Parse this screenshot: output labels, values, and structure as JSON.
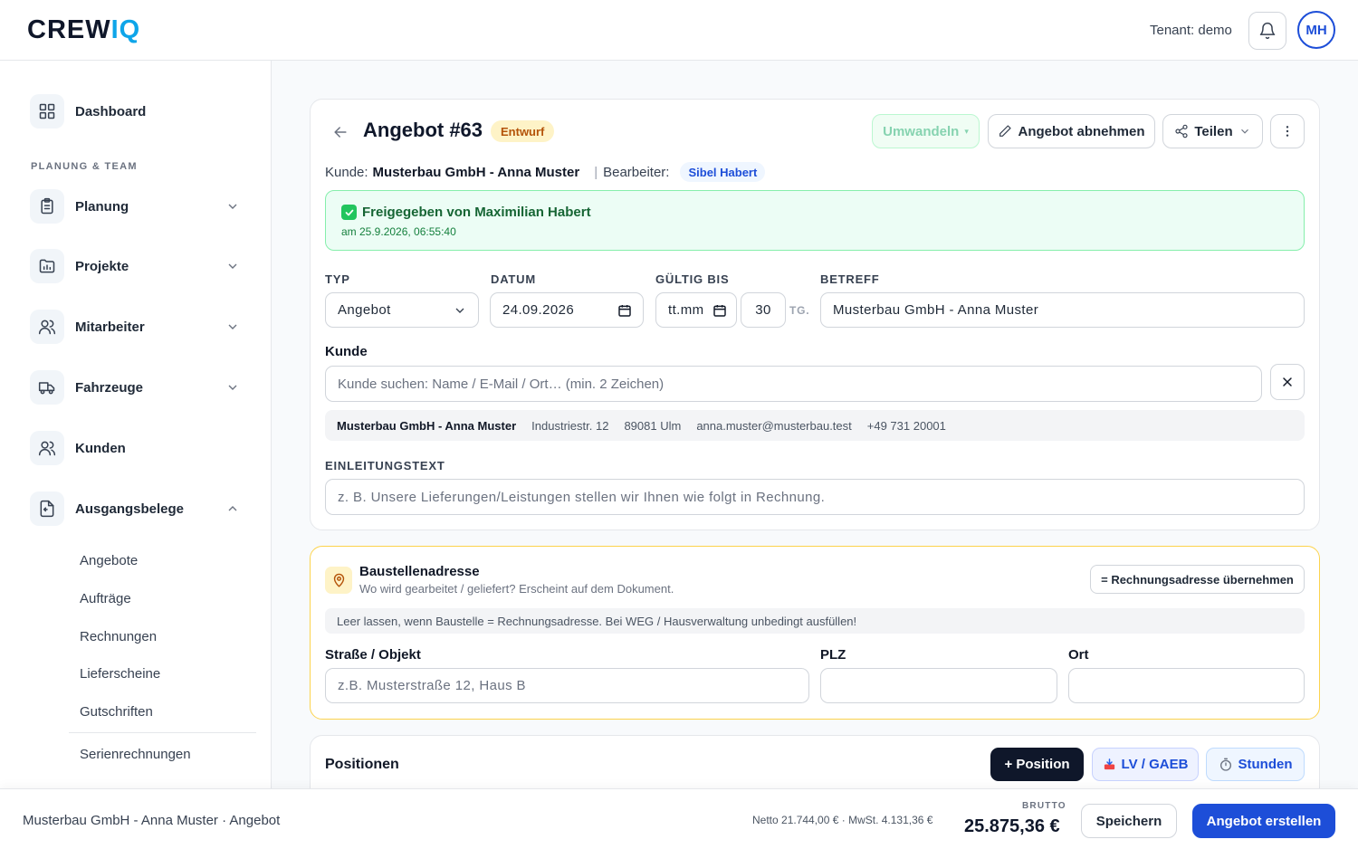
{
  "app": {
    "logo_main": "CREW",
    "logo_accent": "IQ",
    "tenant": "Tenant: demo",
    "user_initials": "MH"
  },
  "sidebar": {
    "dashboard": "Dashboard",
    "section_label": "PLANUNG & TEAM",
    "items": [
      {
        "label": "Planung",
        "icon": "clipboard-icon",
        "expanded": false
      },
      {
        "label": "Projekte",
        "icon": "folder-chart-icon",
        "expanded": false
      },
      {
        "label": "Mitarbeiter",
        "icon": "users-icon",
        "expanded": false
      },
      {
        "label": "Fahrzeuge",
        "icon": "truck-icon",
        "expanded": false
      },
      {
        "label": "Kunden",
        "icon": "users-icon",
        "expanded": null
      },
      {
        "label": "Ausgangsbelege",
        "icon": "document-icon",
        "expanded": true
      }
    ],
    "sub_items": [
      "Angebote",
      "Aufträge",
      "Rechnungen",
      "Lieferscheine",
      "Gutschriften",
      "Serienrechnungen"
    ]
  },
  "header": {
    "title": "Angebot #63",
    "status": "Entwurf",
    "convert_label": "Umwandeln",
    "accept_label": "Angebot abnehmen",
    "share_label": "Teilen",
    "customer_label": "Kunde:",
    "customer_value": "Musterbau GmbH - Anna Muster",
    "separator": "|",
    "editor_label": "Bearbeiter:",
    "editor_value": "Sibel Habert"
  },
  "approval": {
    "title": "Freigegeben von Maximilian Habert",
    "date": "am 25.9.2026, 06:55:40"
  },
  "form": {
    "typ_label": "TYP",
    "typ_value": "Angebot",
    "datum_label": "DATUM",
    "datum_value": "24.09.2026",
    "gueltig_label": "GÜLTIG BIS",
    "gueltig_value": "tt.mm",
    "days_value": "30",
    "days_unit": "TG.",
    "betreff_label": "BETREFF",
    "betreff_value": "Musterbau GmbH - Anna Muster",
    "kunde_label": "Kunde",
    "kunde_placeholder": "Kunde suchen: Name / E-Mail / Ort… (min. 2 Zeichen)",
    "customer": {
      "name": "Musterbau GmbH - Anna Muster",
      "street": "Industriestr. 12",
      "city": "89081 Ulm",
      "email": "anna.muster@musterbau.test",
      "phone": "+49 731 20001"
    },
    "intro_label": "EINLEITUNGSTEXT",
    "intro_placeholder": "z. B. Unsere Lieferungen/Leistungen stellen wir Ihnen wie folgt in Rechnung."
  },
  "site": {
    "title": "Baustellenadresse",
    "subtitle": "Wo wird gearbeitet / geliefert? Erscheint auf dem Dokument.",
    "billing_button": "= Rechnungsadresse übernehmen",
    "hint": "Leer lassen, wenn Baustelle = Rechnungsadresse. Bei WEG / Hausverwaltung unbedingt ausfüllen!",
    "street_label": "Straße / Objekt",
    "street_placeholder": "z.B. Musterstraße 12, Haus B",
    "plz_label": "PLZ",
    "ort_label": "Ort"
  },
  "positions": {
    "title": "Positionen",
    "add_label": "+ Position",
    "lv_label": "LV / GAEB",
    "hours_label": "Stunden"
  },
  "footer": {
    "summary": "Musterbau GmbH - Anna Muster · Angebot",
    "netto": "Netto 21.744,00 € · MwSt. 4.131,36 €",
    "brutto_label": "BRUTTO",
    "brutto_value": "25.875,36 €",
    "save_label": "Speichern",
    "create_label": "Angebot erstellen"
  },
  "colors": {
    "primary": "#1d4ed8",
    "approved_bg": "#ecfdf5",
    "site_border": "#fcd34d",
    "draft_badge": "#fef3c7"
  }
}
